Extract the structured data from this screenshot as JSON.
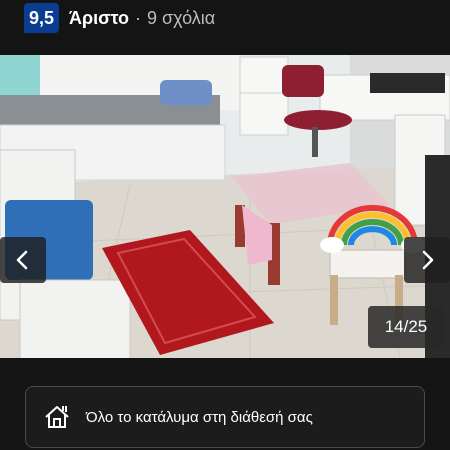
{
  "header": {
    "score": "9,5",
    "rating_label": "Άριστο",
    "separator": "·",
    "reviews": "9 σχόλια"
  },
  "gallery": {
    "counter": "14/25",
    "prev_icon": "chevron-left-icon",
    "next_icon": "chevron-right-icon"
  },
  "feature": {
    "icon": "house-icon",
    "text": "Όλο το κατάλυμα στη διάθεσή σας"
  },
  "colors": {
    "score_badge": "#0a3d91",
    "background": "#141414",
    "rug": "#b0181e"
  }
}
